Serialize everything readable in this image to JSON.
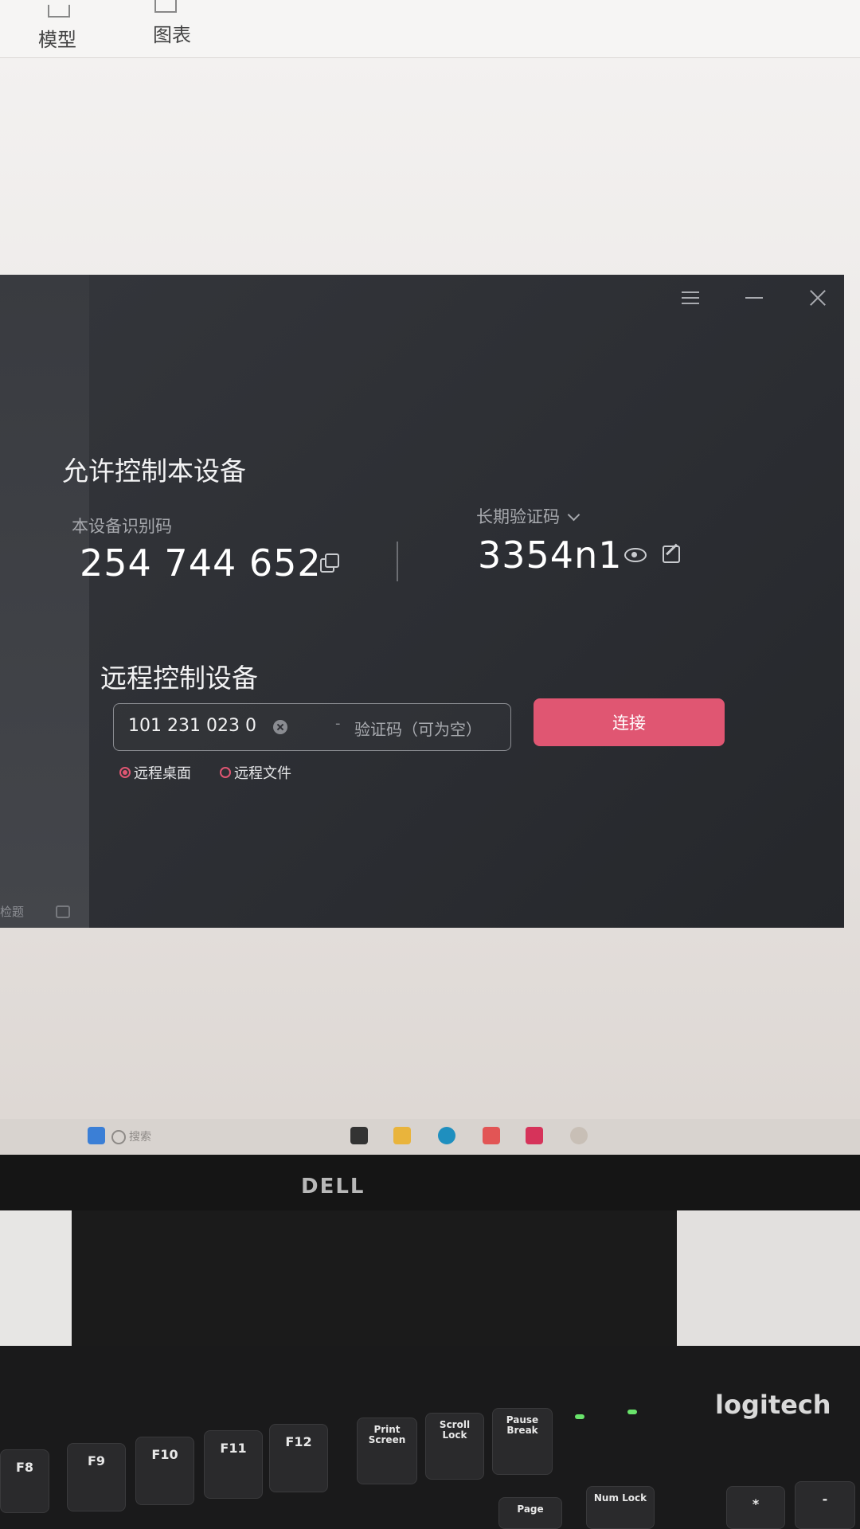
{
  "ribbon": {
    "model_label": "模型",
    "chart_label": "图表"
  },
  "app": {
    "allow_title": "允许控制本设备",
    "device_id_label": "本设备识别码",
    "device_id_value": "254 744 652",
    "password_label": "长期验证码",
    "password_value": "3354n1",
    "remote_title": "远程控制设备",
    "remote_device_input_value": "101 231 023 0",
    "separator": "-",
    "verification_placeholder": "验证码（可为空）",
    "connect_label": "连接",
    "mode_options": [
      {
        "label": "远程桌面",
        "selected": true
      },
      {
        "label": "远程文件",
        "selected": false
      }
    ],
    "sidebar_text": "检题",
    "accent_color": "#e05672"
  },
  "taskbar": {
    "search_placeholder": "搜索"
  },
  "monitor": {
    "brand": "DELL"
  },
  "keyboard": {
    "brand": "logitech",
    "keys": [
      "F8",
      "F9",
      "F10",
      "F11",
      "F12",
      "Print Screen",
      "Scroll Lock",
      "Pause Break",
      "Num Lock",
      "Page",
      "*",
      "-"
    ]
  }
}
